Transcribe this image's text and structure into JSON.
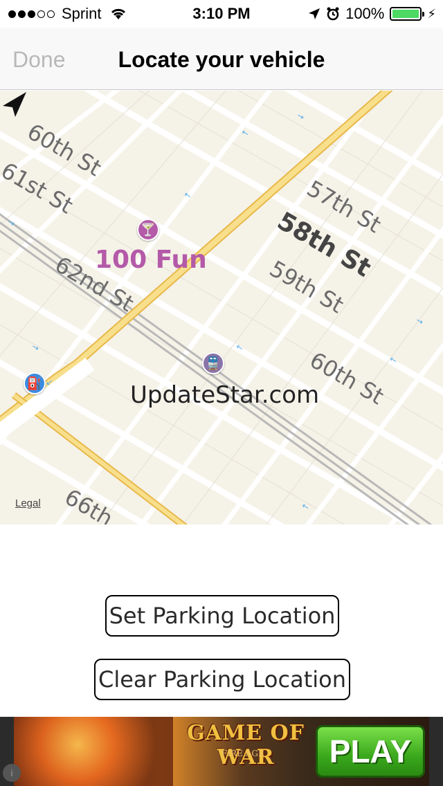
{
  "status_bar": {
    "carrier": "Sprint",
    "time": "3:10 PM",
    "battery": "100%",
    "battery_level": 1.0,
    "signal_bars_filled": 3,
    "signal_bars_total": 5
  },
  "nav": {
    "done_label": "Done",
    "title": "Locate your vehicle"
  },
  "map": {
    "streets": [
      "60th St",
      "61st St",
      "62nd St",
      "57th St",
      "58th St",
      "59th St",
      "60th St",
      "66th"
    ],
    "poi_bar": "100 Fun",
    "poi_station": "UpdateStar.com",
    "legal": "Legal",
    "colors": {
      "background": "#f5f2e8",
      "major_road": "#f3c95e",
      "poi_bar": "#b45aa8",
      "poi_station": "#8a74a8",
      "gas": "#3b8be0"
    }
  },
  "buttons": {
    "set_parking": "Set Parking Location",
    "clear_parking": "Clear Parking Location"
  },
  "ad": {
    "logo": "GAME OF WAR",
    "subtitle": "FIRE AGE",
    "play": "PLAY",
    "info_icon": "i"
  }
}
